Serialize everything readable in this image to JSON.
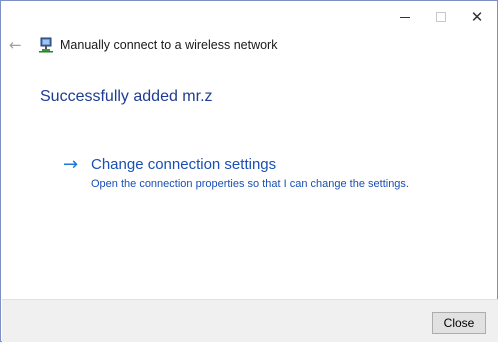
{
  "window": {
    "title_bar": {
      "minimize_icon": "minimize-icon",
      "maximize_icon": "maximize-icon",
      "close_glyph": "✕"
    }
  },
  "header": {
    "back_icon": "back-arrow-icon",
    "network_icon": "network-icon",
    "title": "Manually connect to a wireless network"
  },
  "main": {
    "heading": "Successfully added mr.z",
    "command_link": {
      "arrow_icon": "right-arrow-icon",
      "title": "Change connection settings",
      "description": "Open the connection properties so that I can change the settings."
    }
  },
  "footer": {
    "close_label": "Close"
  },
  "colors": {
    "heading": "#1e3c91",
    "link": "#1a4fb4",
    "link_arrow": "#1a79d4",
    "window_border": "#7d8fc7",
    "footer_bg": "#f0f0f0"
  }
}
